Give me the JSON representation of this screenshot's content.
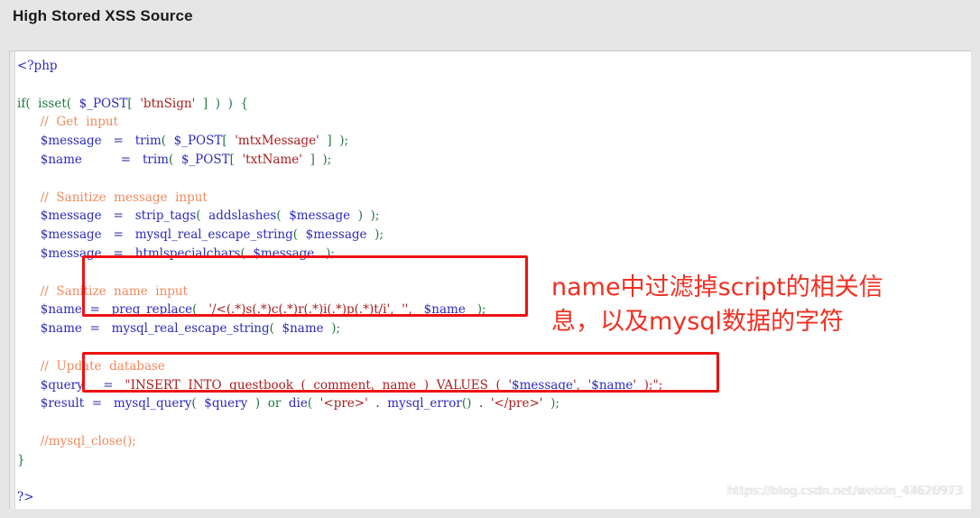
{
  "header": {
    "title": "High Stored XSS Source"
  },
  "code": {
    "language": "php",
    "lines": [
      {
        "id": "open-tag",
        "tokens": [
          {
            "c": "t-tag",
            "s": "<?php"
          }
        ]
      },
      {
        "id": "blank-1",
        "tokens": [
          {
            "c": "t-plain",
            "s": ""
          }
        ]
      },
      {
        "id": "if-isset",
        "tokens": [
          {
            "c": "t-kw",
            "s": "if( "
          },
          {
            "c": "t-kw",
            "s": " isset( "
          },
          {
            "c": "t-var",
            "s": " $_POST"
          },
          {
            "c": "t-punc",
            "s": "[ "
          },
          {
            "c": "t-str",
            "s": " 'btnSign' "
          },
          {
            "c": "t-punc",
            "s": " ]  )  ) "
          },
          {
            "c": "t-punc",
            "s": " {"
          }
        ]
      },
      {
        "id": "comment-get-input",
        "tokens": [
          {
            "c": "t-cmt",
            "s": "      //  Get  input"
          }
        ]
      },
      {
        "id": "assign-message",
        "tokens": [
          {
            "c": "t-var",
            "s": "      $message"
          },
          {
            "c": "t-op",
            "s": "   =  "
          },
          {
            "c": "t-fn",
            "s": " trim"
          },
          {
            "c": "t-punc",
            "s": "( "
          },
          {
            "c": "t-var",
            "s": " $_POST"
          },
          {
            "c": "t-punc",
            "s": "[ "
          },
          {
            "c": "t-str",
            "s": " 'mtxMessage' "
          },
          {
            "c": "t-punc",
            "s": " ]  );"
          }
        ]
      },
      {
        "id": "assign-name",
        "tokens": [
          {
            "c": "t-var",
            "s": "      $name"
          },
          {
            "c": "t-op",
            "s": "          =  "
          },
          {
            "c": "t-fn",
            "s": " trim"
          },
          {
            "c": "t-punc",
            "s": "( "
          },
          {
            "c": "t-var",
            "s": " $_POST"
          },
          {
            "c": "t-punc",
            "s": "[ "
          },
          {
            "c": "t-str",
            "s": " 'txtName' "
          },
          {
            "c": "t-punc",
            "s": " ]  );"
          }
        ]
      },
      {
        "id": "blank-2",
        "tokens": [
          {
            "c": "t-plain",
            "s": ""
          }
        ]
      },
      {
        "id": "comment-sanitize-message",
        "tokens": [
          {
            "c": "t-cmt",
            "s": "      //  Sanitize  message  input"
          }
        ]
      },
      {
        "id": "sanitize-strip-tags",
        "tokens": [
          {
            "c": "t-var",
            "s": "      $message"
          },
          {
            "c": "t-op",
            "s": "   =  "
          },
          {
            "c": "t-fn",
            "s": " strip_tags"
          },
          {
            "c": "t-punc",
            "s": "( "
          },
          {
            "c": "t-fn",
            "s": " addslashes"
          },
          {
            "c": "t-punc",
            "s": "( "
          },
          {
            "c": "t-var",
            "s": " $message "
          },
          {
            "c": "t-punc",
            "s": " )  );"
          }
        ]
      },
      {
        "id": "sanitize-message-escape",
        "tokens": [
          {
            "c": "t-var",
            "s": "      $message"
          },
          {
            "c": "t-op",
            "s": "   =  "
          },
          {
            "c": "t-fn",
            "s": " mysql_real_escape_string"
          },
          {
            "c": "t-punc",
            "s": "( "
          },
          {
            "c": "t-var",
            "s": " $message "
          },
          {
            "c": "t-punc",
            "s": " );"
          }
        ]
      },
      {
        "id": "sanitize-htmlspecialchars",
        "tokens": [
          {
            "c": "t-var",
            "s": "      $message"
          },
          {
            "c": "t-op",
            "s": "   =  "
          },
          {
            "c": "t-fn",
            "s": " htmlspecialchars"
          },
          {
            "c": "t-punc",
            "s": "( "
          },
          {
            "c": "t-var",
            "s": " $message  "
          },
          {
            "c": "t-punc",
            "s": " );"
          }
        ]
      },
      {
        "id": "blank-3",
        "tokens": [
          {
            "c": "t-plain",
            "s": ""
          }
        ]
      },
      {
        "id": "comment-sanitize-name",
        "tokens": [
          {
            "c": "t-cmt",
            "s": "      //  Sanitize  name  input"
          }
        ]
      },
      {
        "id": "sanitize-preg-replace",
        "tokens": [
          {
            "c": "t-var",
            "s": "      $name"
          },
          {
            "c": "t-op",
            "s": "  =  "
          },
          {
            "c": "t-fn",
            "s": " preg_replace"
          },
          {
            "c": "t-punc",
            "s": "( "
          },
          {
            "c": "t-str",
            "s": "  '/<(.*)s(.*)c(.*)r(.*)i(.*)p(.*)t/i',"
          },
          {
            "c": "t-str",
            "s": "  '',"
          },
          {
            "c": "t-var",
            "s": "   $name "
          },
          {
            "c": "t-punc",
            "s": "  );"
          }
        ]
      },
      {
        "id": "sanitize-name-escape",
        "tokens": [
          {
            "c": "t-var",
            "s": "      $name"
          },
          {
            "c": "t-op",
            "s": "  =  "
          },
          {
            "c": "t-fn",
            "s": " mysql_real_escape_string"
          },
          {
            "c": "t-punc",
            "s": "( "
          },
          {
            "c": "t-var",
            "s": " $name "
          },
          {
            "c": "t-punc",
            "s": " );"
          }
        ]
      },
      {
        "id": "blank-4",
        "tokens": [
          {
            "c": "t-plain",
            "s": ""
          }
        ]
      },
      {
        "id": "comment-update-database",
        "tokens": [
          {
            "c": "t-cmt",
            "s": "      //  Update  database"
          }
        ]
      },
      {
        "id": "assign-query",
        "tokens": [
          {
            "c": "t-var",
            "s": "      $query"
          },
          {
            "c": "t-op",
            "s": "     =  "
          },
          {
            "c": "t-str",
            "s": " \"INSERT  INTO  guestbook  (  comment,  name  )  VALUES  ( "
          },
          {
            "c": "t-str",
            "s": " '"
          },
          {
            "c": "t-var",
            "s": "$message"
          },
          {
            "c": "t-str",
            "s": "',  '"
          },
          {
            "c": "t-var",
            "s": "$name"
          },
          {
            "c": "t-str",
            "s": "'  );\";"
          }
        ]
      },
      {
        "id": "assign-result",
        "tokens": [
          {
            "c": "t-var",
            "s": "      $result"
          },
          {
            "c": "t-op",
            "s": "  =  "
          },
          {
            "c": "t-fn",
            "s": " mysql_query"
          },
          {
            "c": "t-punc",
            "s": "( "
          },
          {
            "c": "t-var",
            "s": " $query "
          },
          {
            "c": "t-punc",
            "s": " ) "
          },
          {
            "c": "t-kw",
            "s": " or "
          },
          {
            "c": "t-fn",
            "s": " die"
          },
          {
            "c": "t-punc",
            "s": "( "
          },
          {
            "c": "t-str",
            "s": " '<pre>' "
          },
          {
            "c": "t-plain",
            "s": " . "
          },
          {
            "c": "t-fn",
            "s": " mysql_error"
          },
          {
            "c": "t-punc",
            "s": "() "
          },
          {
            "c": "t-plain",
            "s": " . "
          },
          {
            "c": "t-str",
            "s": " '</pre>' "
          },
          {
            "c": "t-punc",
            "s": " );"
          }
        ]
      },
      {
        "id": "blank-5",
        "tokens": [
          {
            "c": "t-plain",
            "s": ""
          }
        ]
      },
      {
        "id": "comment-mysql-close",
        "tokens": [
          {
            "c": "t-cmt",
            "s": "      //mysql_close();"
          }
        ]
      },
      {
        "id": "close-brace",
        "tokens": [
          {
            "c": "t-kw",
            "s": "}"
          }
        ]
      },
      {
        "id": "blank-6",
        "tokens": [
          {
            "c": "t-plain",
            "s": ""
          }
        ]
      },
      {
        "id": "close-tag",
        "tokens": [
          {
            "c": "t-tag",
            "s": "?>"
          }
        ]
      }
    ]
  },
  "annotations": {
    "boxes": [
      {
        "id": "message-sanitize",
        "label": "message sanitize highlight",
        "color": "#ee1111"
      },
      {
        "id": "name-sanitize",
        "label": "name sanitize highlight",
        "color": "#ee1111"
      }
    ],
    "note": {
      "color": "#ef3022",
      "line1": "name中过滤掉script的相关信",
      "line2": "息，以及mysql数据的字符"
    }
  },
  "watermark": {
    "text": "https://blog.csdn.net/weixin_44620973",
    "overlay_text": "https://blog.csdn.net/weixin_43626913"
  }
}
